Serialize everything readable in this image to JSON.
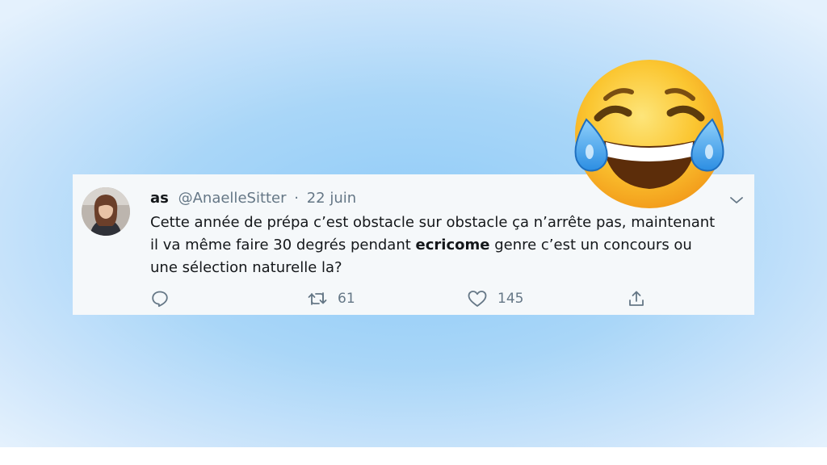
{
  "tweet": {
    "display_name": "as",
    "handle": "@AnaelleSitter",
    "separator": "·",
    "date": "22 juin",
    "text_line1": "Cette année de prépa c’est obstacle sur obstacle ça n’arrête pas, maintenant",
    "text_line2_before": "il va même faire 30 degrés pendant ",
    "text_line2_bold": "ecricome",
    "text_line2_after": " genre c’est un concours ou",
    "text_line3": "une sélection naturelle la?"
  },
  "actions": {
    "reply_icon": "reply-icon",
    "retweet_icon": "retweet-icon",
    "retweet_count": "61",
    "like_icon": "heart-icon",
    "like_count": "145",
    "share_icon": "share-icon"
  },
  "decoration": {
    "emoji": "face-with-tears-of-joy"
  },
  "colors": {
    "background": "#a9d6f8",
    "card": "#f5f8fa",
    "text": "#14171a",
    "muted": "#657786"
  }
}
